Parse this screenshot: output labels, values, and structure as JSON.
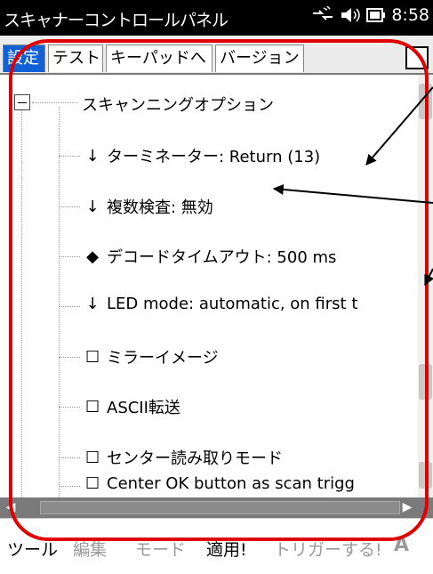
{
  "window": {
    "title": "スキャナーコントロールパネル",
    "time": "8:58",
    "status_icons": [
      "connection-icon",
      "speaker-icon",
      "battery-icon"
    ]
  },
  "tabs": [
    {
      "label": "設定",
      "active": true
    },
    {
      "label": "テスト",
      "active": false
    },
    {
      "label": "キーパッドへ",
      "active": false
    },
    {
      "label": "バージョン",
      "active": false
    }
  ],
  "tree": {
    "root_label": "スキャンニングオプション",
    "items": [
      {
        "marker": "↓",
        "label": "ターミネーター: Return (13)"
      },
      {
        "marker": "↓",
        "label": "複数検査: 無効"
      },
      {
        "marker": "◆",
        "label": "デコードタイムアウト: 500 ms"
      },
      {
        "marker": "↓",
        "label": "LED mode: automatic, on first t"
      },
      {
        "marker": "☐",
        "label": "ミラーイメージ"
      },
      {
        "marker": "☐",
        "label": "ASCII転送"
      },
      {
        "marker": "☐",
        "label": "センター読み取りモード"
      },
      {
        "marker": "☐",
        "label": "Center OK button as scan trigg"
      }
    ]
  },
  "menu": {
    "tools": "ツール",
    "edit": "編集",
    "mode": "モード",
    "apply": "適用!",
    "trigger": "トリガーする!",
    "sip": "A"
  },
  "colors": {
    "active_tab": "#1060d6",
    "annotation": "#e00000",
    "arrow": "#000000",
    "disabled_text": "#9a9a9a"
  }
}
